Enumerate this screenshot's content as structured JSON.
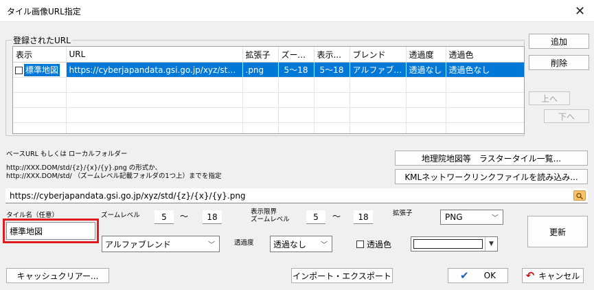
{
  "window": {
    "title": "タイル画像URL指定",
    "close_glyph": "✕"
  },
  "registered": {
    "group_label": "登録されたURL",
    "columns": [
      "表示",
      "URL",
      "拡張子",
      "ズーム...",
      "表示...",
      "ブレンド",
      "透過度",
      "透過色"
    ],
    "rows": [
      {
        "checked": false,
        "name": "標準地図",
        "url": "https://cyberjapandata.gsi.go.jp/xyz/std/...",
        "ext": ".png",
        "zoom": "5～18",
        "display": "5～18",
        "blend": "アルファブレ...",
        "opacity": "透過なし",
        "trans_color": "透過色なし"
      }
    ]
  },
  "side_buttons": {
    "add": "追加",
    "delete": "削除",
    "up": "上へ",
    "down": "下へ"
  },
  "base_url": {
    "label": "ベースURL もしくは ローカルフォルダー",
    "help1": "http://XXX.DOM/std/{z}/{x}/{y}.png の形式か、",
    "help2": "http://XXX.DOM/std/ （ズームレベル記載フォルダの1つ上）までを指定",
    "value": "https://cyberjapandata.gsi.go.jp/xyz/std/{z}/{x}/{y}.png"
  },
  "buttons": {
    "gsi_list": "地理院地図等　ラスタータイル一覧...",
    "kml_load": "KMLネットワークリンクファイルを読み込み...",
    "update": "更新",
    "cache_clear": "キャッシュクリアー...",
    "import_export": "インポート・エクスポート",
    "ok": "OK",
    "cancel": "キャンセル"
  },
  "form": {
    "tile_name_label": "タイル名（任意）",
    "tile_name": "標準地図",
    "zoom_label": "ズームレベル",
    "zoom_min": "5",
    "zoom_max": "18",
    "range_sep": "～",
    "display_label_1": "表示限界",
    "display_label_2": "ズームレベル",
    "display_min": "5",
    "display_max": "18",
    "ext_label": "拡張子",
    "ext_value": "PNG",
    "blend_value": "アルファブレンド",
    "opacity_label": "透過度",
    "opacity_value": "透過なし",
    "trans_color_label": "透過色",
    "trans_color_checked": false
  },
  "colors": {
    "selection": "#0078d7",
    "highlight_border": "#e11b22",
    "ok_check": "#1a5fb4",
    "cancel_icon": "#d01010"
  },
  "icons": {
    "browse": "folder-search-icon",
    "ok": "check-icon",
    "cancel": "undo-arrow-icon"
  }
}
